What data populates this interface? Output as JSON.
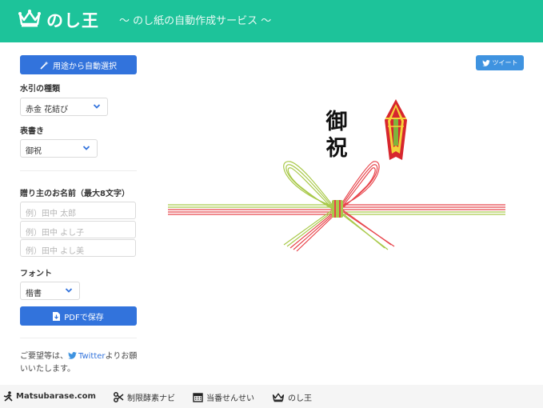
{
  "header": {
    "logo_text": "のし王",
    "tagline": "〜 のし紙の自動作成サービス 〜"
  },
  "sidebar": {
    "auto_select_button": "用途から自動選択",
    "mizuhiki_label": "水引の種類",
    "mizuhiki_value": "赤金 花結び",
    "omotegaki_label": "表書き",
    "omotegaki_value": "御祝",
    "names_label": "贈り主のお名前（最大8文字）",
    "name_placeholders": [
      "例）田中 太郎",
      "例）田中 よし子",
      "例）田中 よし美"
    ],
    "font_label": "フォント",
    "font_value": "楷書",
    "save_pdf_button": "PDFで保存"
  },
  "tweet_button": "ツイート",
  "noshi": {
    "omotegaki_char_1": "御",
    "omotegaki_char_2": "祝"
  },
  "note": {
    "prefix": "ご要望等は、",
    "twitter_link": "Twitter",
    "suffix": "よりお願いいたします。"
  },
  "footer": {
    "items": [
      "Matsubarase.com",
      "制限酵素ナビ",
      "当番せんせい",
      "のし王"
    ]
  },
  "colors": {
    "header_bg": "#1dc39a",
    "primary_button": "#3273dc",
    "tweet_button": "#3f93e0",
    "mizuhiki_red": "#e8444b",
    "mizuhiki_green": "#a9c94a"
  }
}
